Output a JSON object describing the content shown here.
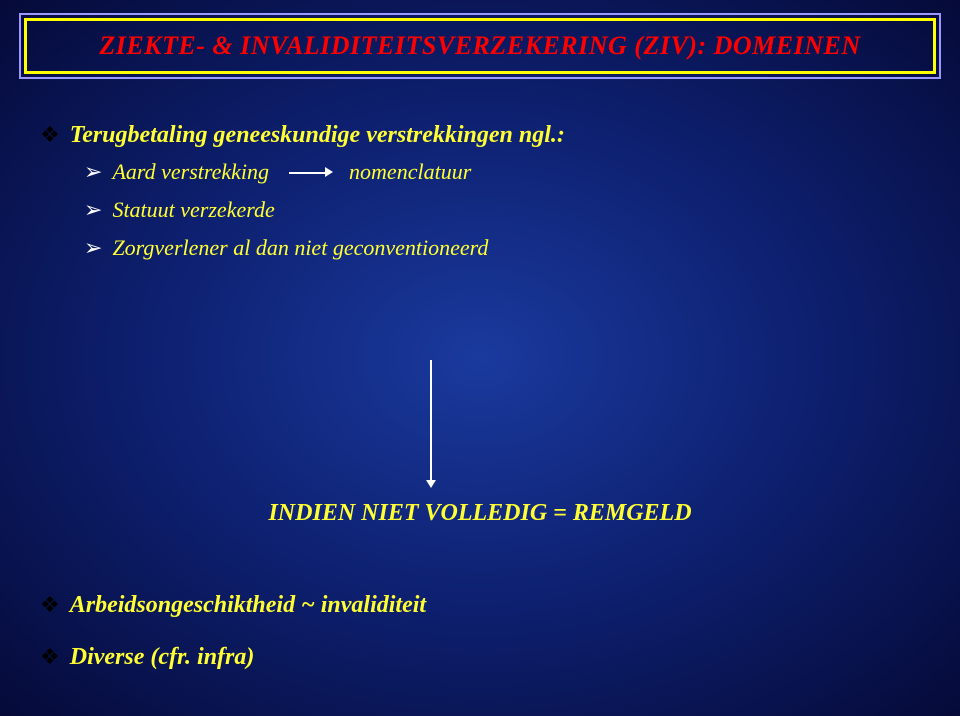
{
  "title": "ZIEKTE- & INVALIDITEITSVERZEKERING (ZIV): DOMEINEN",
  "section1": {
    "heading": "Terugbetaling geneeskundige verstrekkingen ngl.:",
    "items": {
      "i0a": "Aard verstrekking",
      "i0b": "nomenclatuur",
      "i1": "Statuut verzekerde",
      "i2": "Zorgverlener al dan niet geconventioneerd"
    }
  },
  "middle": "INDIEN NIET VOLLEDIG = REMGELD",
  "section2": "Arbeidsongeschiktheid ~ invaliditeit",
  "section3": "Diverse (cfr. infra)"
}
